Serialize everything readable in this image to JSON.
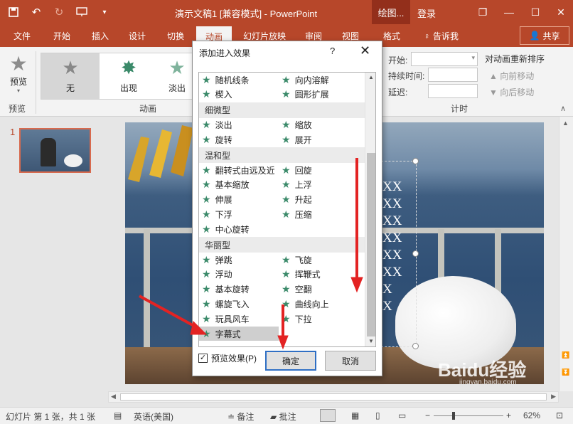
{
  "titlebar": {
    "doc_title": "演示文稿1 [兼容模式] - PowerPoint",
    "context_tab": "绘图...",
    "login": "登录",
    "minimize": "—",
    "restore": "❐",
    "maximize": "☐",
    "close": "✕"
  },
  "tabs": [
    "文件",
    "开始",
    "插入",
    "设计",
    "切换",
    "动画",
    "幻灯片放映",
    "审阅",
    "视图",
    "格式"
  ],
  "tellme": "告诉我",
  "share": "共享",
  "ribbon": {
    "preview_label": "预览",
    "preview_group": "预览",
    "anim_group": "动画",
    "timing_group": "计时",
    "effects": [
      "无",
      "出现",
      "淡出"
    ],
    "start_label": "开始:",
    "duration_label": "持续时间:",
    "delay_label": "延迟:",
    "reorder_title": "对动画重新排序",
    "move_earlier": "向前移动",
    "move_later": "向后移动"
  },
  "slide_panel": {
    "number": "1"
  },
  "slide_text": [
    "XX",
    "XX",
    "XX",
    "XX",
    "XX",
    "XX",
    "X",
    "X"
  ],
  "dialog": {
    "title": "添加进入效果",
    "help": "?",
    "close": "✕",
    "rows": [
      {
        "left": "随机线条",
        "right": "向内溶解"
      },
      {
        "left": "楔入",
        "right": "圆形扩展"
      },
      {
        "category": "细微型"
      },
      {
        "left": "淡出",
        "right": "缩放"
      },
      {
        "left": "旋转",
        "right": "展开"
      },
      {
        "category": "温和型"
      },
      {
        "left": "翻转式由远及近",
        "right": "回旋"
      },
      {
        "left": "基本缩放",
        "right": "上浮"
      },
      {
        "left": "伸展",
        "right": "升起"
      },
      {
        "left": "下浮",
        "right": "压缩"
      },
      {
        "left": "中心旋转",
        "right": ""
      },
      {
        "category": "华丽型"
      },
      {
        "left": "弹跳",
        "right": "飞旋"
      },
      {
        "left": "浮动",
        "right": "挥鞭式"
      },
      {
        "left": "基本旋转",
        "right": "空翻"
      },
      {
        "left": "螺旋飞入",
        "right": "曲线向上"
      },
      {
        "left": "玩具风车",
        "right": "下拉"
      },
      {
        "left": "字幕式",
        "right": "",
        "selected": true
      }
    ],
    "preview_checkbox": "预览效果(P)",
    "ok": "确定",
    "cancel": "取消"
  },
  "status": {
    "slide_info": "幻灯片 第 1 张，共 1 张",
    "language": "英语(美国)",
    "notes": "备注",
    "comments": "批注",
    "zoom": "62%"
  },
  "watermark": "Baidu经验",
  "watermark_url": "jingyan.baidu.com",
  "colors": {
    "brand": "#b7472a",
    "star": "#3b8a6a",
    "annotation": "#e32323"
  }
}
